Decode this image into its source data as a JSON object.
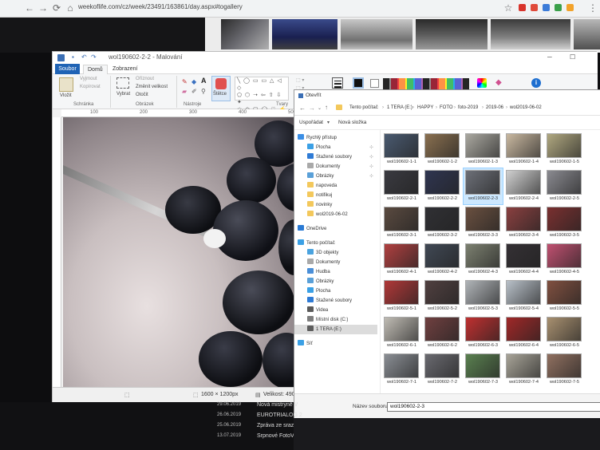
{
  "browser": {
    "url": "weekoflife.com/cz/week/23491/163861/day.aspx#togallery"
  },
  "paint": {
    "title": "wol190602-2-2 - Malování",
    "tabs": {
      "file": "Soubor",
      "home": "Domů",
      "view": "Zobrazení"
    },
    "clipboard": {
      "paste": "Vložit",
      "cut": "Vyjmout",
      "copy": "Kopírovat",
      "group": "Schránka"
    },
    "image": {
      "select": "Vybrat",
      "crop": "Oříznout",
      "resize": "Změnit velikost",
      "rotate": "Otočit",
      "group": "Obrázek"
    },
    "tools": {
      "letter": "A",
      "group": "Nástroje"
    },
    "brushes": {
      "label": "Štětce"
    },
    "shapes": {
      "group": "Tvary"
    },
    "ruler": [
      "100",
      "200",
      "300",
      "400",
      "500",
      "600",
      "700",
      "800"
    ],
    "status": {
      "size": "1600 × 1200px",
      "filesize": "Velikost: 490,3"
    }
  },
  "dialog": {
    "title": "Otevřít",
    "breadcrumb": [
      "Tento počítač",
      "1 TERA (E:)",
      "HAPPY",
      "FOTO",
      "foto-2019",
      "2019-06",
      "wol2019-06-02"
    ],
    "toolbar": {
      "organize": "Uspořádat",
      "new_folder": "Nová složka"
    },
    "tree": [
      {
        "label": "Rychlý přístup",
        "icon": "star-icon",
        "color": "#3b8ee5"
      },
      {
        "label": "Plocha",
        "icon": "desktop-icon",
        "color": "#3ba0e5",
        "pinned": true
      },
      {
        "label": "Stažené soubory",
        "icon": "download-icon",
        "color": "#2f7bd5",
        "pinned": true
      },
      {
        "label": "Dokumenty",
        "icon": "documents-icon",
        "color": "#a9a9a9",
        "pinned": true
      },
      {
        "label": "Obrázky",
        "icon": "pictures-icon",
        "color": "#5aa0d8",
        "pinned": true
      },
      {
        "label": "napoveda",
        "icon": "folder-icon",
        "color": "#f3c85c"
      },
      {
        "label": "notifikuj",
        "icon": "folder-icon",
        "color": "#f3c85c"
      },
      {
        "label": "novinky",
        "icon": "folder-icon",
        "color": "#f3c85c"
      },
      {
        "label": "wol2019-06-02",
        "icon": "folder-icon",
        "color": "#f3c85c"
      },
      {
        "label": "OneDrive",
        "icon": "onedrive-icon",
        "color": "#2a7ad4"
      },
      {
        "label": "Tento počítač",
        "icon": "computer-icon",
        "color": "#3ba0e5"
      },
      {
        "label": "3D objekty",
        "icon": "cube-icon",
        "color": "#4aa3df"
      },
      {
        "label": "Dokumenty",
        "icon": "documents-icon",
        "color": "#a9a9a9"
      },
      {
        "label": "Hudba",
        "icon": "music-icon",
        "color": "#4a8fd8"
      },
      {
        "label": "Obrázky",
        "icon": "pictures-icon",
        "color": "#5aa0d8"
      },
      {
        "label": "Plocha",
        "icon": "desktop-icon",
        "color": "#3ba0e5"
      },
      {
        "label": "Stažené soubory",
        "icon": "download-icon",
        "color": "#2f7bd5"
      },
      {
        "label": "Videa",
        "icon": "video-icon",
        "color": "#5a5a5a"
      },
      {
        "label": "Místní disk (C:)",
        "icon": "drive-icon",
        "color": "#7d7d7d"
      },
      {
        "label": "1 TERA (E:)",
        "icon": "drive-icon",
        "color": "#5d5d5d",
        "selected": true
      },
      {
        "label": "Síť",
        "icon": "network-icon",
        "color": "#3ba0e5"
      }
    ],
    "files": [
      {
        "name": "wol190602-1-1",
        "color": "#4a5a70"
      },
      {
        "name": "wol190602-1-2",
        "color": "#8a7050"
      },
      {
        "name": "wol190602-1-3",
        "color": "#aaa8a0"
      },
      {
        "name": "wol190602-1-4",
        "color": "#c9b8a0"
      },
      {
        "name": "wol190602-1-5",
        "color": "#b0a880"
      },
      {
        "name": "wol190602-2-1",
        "color": "#3a3a40"
      },
      {
        "name": "wol190602-2-2",
        "color": "#2f3550"
      },
      {
        "name": "wol190602-2-3",
        "color": "#6d7078",
        "selected": true
      },
      {
        "name": "wol190602-2-4",
        "color": "#d0d0d0"
      },
      {
        "name": "wol190602-2-5",
        "color": "#8a8a90"
      },
      {
        "name": "wol190602-3-1",
        "color": "#5a4a40"
      },
      {
        "name": "wol190602-3-2",
        "color": "#303034"
      },
      {
        "name": "wol190602-3-3",
        "color": "#6a5040"
      },
      {
        "name": "wol190602-3-4",
        "color": "#8a4040"
      },
      {
        "name": "wol190602-3-5",
        "color": "#7a3030"
      },
      {
        "name": "wol190602-4-1",
        "color": "#b04040"
      },
      {
        "name": "wol190602-4-2",
        "color": "#404854"
      },
      {
        "name": "wol190602-4-3",
        "color": "#7c8070"
      },
      {
        "name": "wol190602-4-4",
        "color": "#343034"
      },
      {
        "name": "wol190602-4-5",
        "color": "#c05070"
      },
      {
        "name": "wol190602-5-1",
        "color": "#b03838"
      },
      {
        "name": "wol190602-5-2",
        "color": "#504040"
      },
      {
        "name": "wol190602-5-3",
        "color": "#b0b4b8"
      },
      {
        "name": "wol190602-5-4",
        "color": "#b8c0c8"
      },
      {
        "name": "wol190602-5-5",
        "color": "#805040"
      },
      {
        "name": "wol190602-6-1",
        "color": "#c0bcb4"
      },
      {
        "name": "wol190602-6-2",
        "color": "#704040"
      },
      {
        "name": "wol190602-6-3",
        "color": "#c03030"
      },
      {
        "name": "wol190602-6-4",
        "color": "#a02828"
      },
      {
        "name": "wol190602-6-5",
        "color": "#a89070"
      },
      {
        "name": "wol190602-7-1",
        "color": "#8a8e94"
      },
      {
        "name": "wol190602-7-2",
        "color": "#6a6a70"
      },
      {
        "name": "wol190602-7-3",
        "color": "#5a8050"
      },
      {
        "name": "wol190602-7-4",
        "color": "#a8a498"
      },
      {
        "name": "wol190602-7-5",
        "color": "#907060"
      }
    ],
    "footer": {
      "filename_label": "Název souboru:",
      "filename_value": "wol190602-2-3"
    }
  },
  "below": {
    "news": [
      {
        "date": "29.06.2019",
        "text": "Nová mistrynĕ V"
      },
      {
        "date": "26.06.2019",
        "text": "EUROTRIALOG 2"
      },
      {
        "date": "25.06.2019",
        "text": "Zpráva ze srazu"
      },
      {
        "date": "13.07.2019",
        "text": "Srpnové FotoVide"
      }
    ]
  }
}
